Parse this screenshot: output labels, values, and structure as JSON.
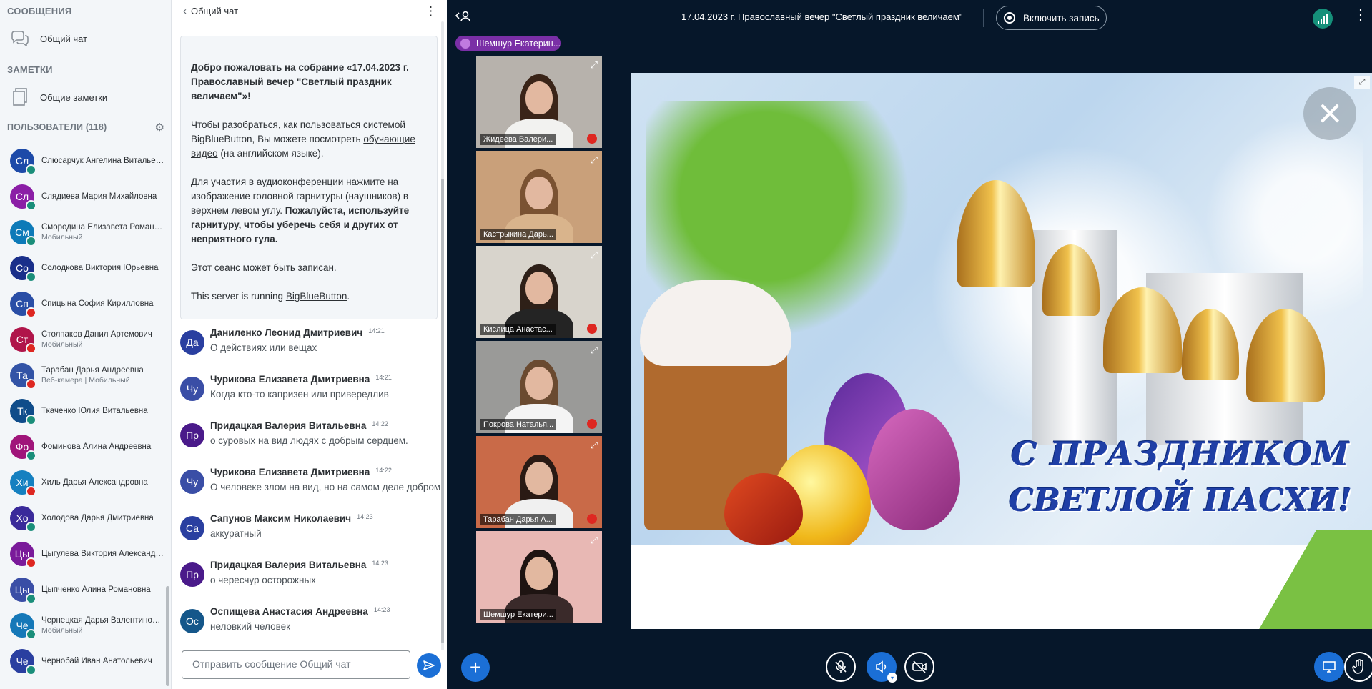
{
  "sidebar": {
    "messages_title": "СООБЩЕНИЯ",
    "public_chat": "Общий чат",
    "notes_title": "ЗАМЕТКИ",
    "shared_notes": "Общие заметки",
    "users_title": "ПОЛЬЗОВАТЕЛИ (118)",
    "users": [
      {
        "initials": "Сл",
        "name": "Слюсарчук Ангелина Витальев...",
        "sub": "",
        "color": "#1d4aa8",
        "status": "ok"
      },
      {
        "initials": "Сл",
        "name": "Слядиева Мария Михайловна",
        "sub": "",
        "color": "#8b1ea6",
        "status": "ok"
      },
      {
        "initials": "См",
        "name": "Смородина Елизавета Романо...",
        "sub": "Мобильный",
        "color": "#0d7ab8",
        "status": "ok"
      },
      {
        "initials": "Со",
        "name": "Солодкова Виктория Юрьевна",
        "sub": "",
        "color": "#1a2f8a",
        "status": "ok"
      },
      {
        "initials": "Сп",
        "name": "Спицына София Кирилловна",
        "sub": "",
        "color": "#2a4ea6",
        "status": "mute"
      },
      {
        "initials": "Ст",
        "name": "Столпаков Данил Артемович",
        "sub": "Мобильный",
        "color": "#b0154a",
        "status": "mute"
      },
      {
        "initials": "Та",
        "name": "Тарабан Дарья Андреевна",
        "sub": "Веб-камера | Мобильный",
        "color": "#3253a6",
        "status": "mute"
      },
      {
        "initials": "Тк",
        "name": "Ткаченко Юлия Витальевна",
        "sub": "",
        "color": "#0f4c8a",
        "status": "ok"
      },
      {
        "initials": "Фо",
        "name": "Фоминова Алина Андреевна",
        "sub": "",
        "color": "#a0157a",
        "status": "ok"
      },
      {
        "initials": "Хи",
        "name": "Хиль Дарья Александровна",
        "sub": "",
        "color": "#1580c0",
        "status": "mute"
      },
      {
        "initials": "Хо",
        "name": "Холодова Дарья Дмитриевна",
        "sub": "",
        "color": "#3a2a9a",
        "status": "ok"
      },
      {
        "initials": "Цы",
        "name": "Цыгулева Виктория Александр...",
        "sub": "",
        "color": "#7a1a9a",
        "status": "mute"
      },
      {
        "initials": "Цы",
        "name": "Цыпченко Алина Романовна",
        "sub": "",
        "color": "#3a4ea6",
        "status": "ok"
      },
      {
        "initials": "Че",
        "name": "Чернецкая Дарья Валентиновна",
        "sub": "Мобильный",
        "color": "#1578b8",
        "status": "ok"
      },
      {
        "initials": "Че",
        "name": "Чернобай Иван Анатольевич",
        "sub": "",
        "color": "#2a3fa0",
        "status": "ok"
      }
    ]
  },
  "chat": {
    "title": "Общий чат",
    "welcome": {
      "p1_pre": "Добро пожаловать на собрание «",
      "p1_bold": "17.04.2023 г. Православный вечер \"Светлый праздник величаем\"",
      "p1_post": "»!",
      "p2_pre": "Чтобы разобраться, как пользоваться системой BigBlueButton, Вы можете посмотреть ",
      "p2_link": "обучающие видео",
      "p2_post": " (на английском языке).",
      "p3_pre": "Для участия в аудиоконференции нажмите на изображение головной гарнитуры (наушников) в верхнем левом углу. ",
      "p3_bold": "Пожалуйста, используйте гарнитуру, чтобы уберечь себя и других от неприятного гула.",
      "p4": "Этот сеанс может быть записан.",
      "p5_pre": "This server is running ",
      "p5_link": "BigBlueButton",
      "p5_post": "."
    },
    "messages": [
      {
        "initials": "Да",
        "color": "#2a3fa0",
        "name": "Даниленко Леонид Дмитриевич",
        "time": "14:21",
        "text": "О действиях или вещах"
      },
      {
        "initials": "Чу",
        "color": "#3a4ea6",
        "name": "Чурикова Елизавета Дмитриевна",
        "time": "14:21",
        "text": "Когда кто-то капризен или привередлив"
      },
      {
        "initials": "Пр",
        "color": "#4a1a8a",
        "name": "Придацкая Валерия Витальевна",
        "time": "14:22",
        "text": "о суровых на вид людях с добрым сердцем."
      },
      {
        "initials": "Чу",
        "color": "#3a4ea6",
        "name": "Чурикова Елизавета Дмитриевна",
        "time": "14:22",
        "text": "О человеке злом на вид, но на самом деле добром"
      },
      {
        "initials": "Са",
        "color": "#2a3fa0",
        "name": "Сапунов Максим Николаевич",
        "time": "14:23",
        "text": "аккуратный"
      },
      {
        "initials": "Пр",
        "color": "#4a1a8a",
        "name": "Придацкая Валерия Витальевна",
        "time": "14:23",
        "text": "о чересчур осторожных"
      },
      {
        "initials": "Ос",
        "color": "#15578a",
        "name": "Оспищева Анастасия Андреевна",
        "time": "14:23",
        "text": "неловкий человек"
      }
    ],
    "composer_placeholder": "Отправить сообщение Общий чат"
  },
  "topbar": {
    "meeting_title": "17.04.2023 г. Православный вечер \"Светлый праздник величаем\"",
    "record_label": "Включить запись"
  },
  "talking": "Шемшур Екатерин...",
  "videos": [
    {
      "name": "Жидеева Валери...",
      "bg": "#b7b2ac",
      "hair": "#3a2418",
      "body": "#f2f2f0",
      "muted": true
    },
    {
      "name": "Кастрыкина Дарь...",
      "bg": "#c9a07a",
      "hair": "#7a5232",
      "body": "#d9b48c",
      "muted": false
    },
    {
      "name": "Кислица Анастас...",
      "bg": "#d8d4cc",
      "hair": "#2e2018",
      "body": "#242424",
      "muted": true
    },
    {
      "name": "Покрова Наталья...",
      "bg": "#9a9a98",
      "hair": "#6a4a30",
      "body": "#f4f4f4",
      "muted": true
    },
    {
      "name": "Тарабан Дарья А...",
      "bg": "#c96a48",
      "hair": "#2a1a14",
      "body": "#f0f0f0",
      "muted": true
    },
    {
      "name": "Шемшур Екатери...",
      "bg": "#e8b8b4",
      "hair": "#1e1412",
      "body": "#3a2a2a",
      "muted": false
    }
  ],
  "slide": {
    "line1": "С ПРАЗДНИКОМ",
    "line2": "СВЕТЛОЙ ПАСХИ!"
  },
  "icons": {
    "chat": "chat-icon",
    "notes": "notes-icon",
    "settings": "gear-icon",
    "back": "chevron-left-icon",
    "menu": "more-vertical-icon",
    "send": "send-icon",
    "plus": "plus-icon",
    "mic": "mic-muted-icon",
    "audio": "speaker-icon",
    "camera": "camera-off-icon",
    "screenshare": "screen-share-icon",
    "raise_hand": "raise-hand-icon"
  },
  "colors": {
    "accent": "#1b6fd6",
    "background": "#06172a",
    "talking": "#7a2fa6"
  }
}
